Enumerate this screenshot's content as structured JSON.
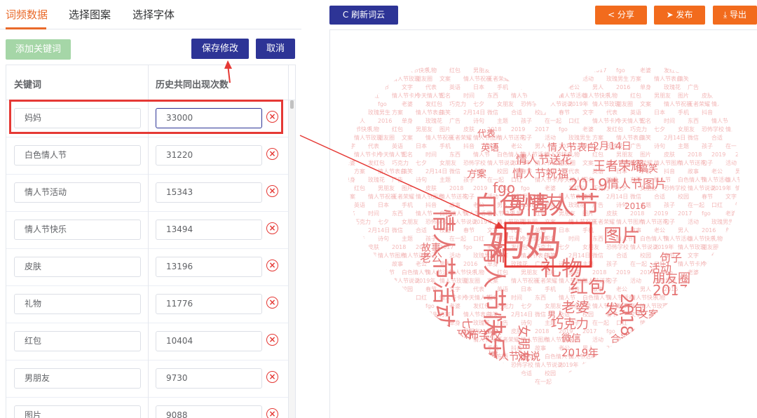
{
  "tabs": [
    {
      "label": "词频数据",
      "active": true
    },
    {
      "label": "选择图案",
      "active": false
    },
    {
      "label": "选择字体",
      "active": false
    }
  ],
  "buttons": {
    "add_keyword": "添加关键词",
    "save": "保存修改",
    "cancel": "取消"
  },
  "table": {
    "columns": [
      "关键词",
      "历史共同出现次数"
    ],
    "rows": [
      {
        "keyword": "妈妈",
        "count": "33000"
      },
      {
        "keyword": "白色情人节",
        "count": "31220"
      },
      {
        "keyword": "情人节活动",
        "count": "15343"
      },
      {
        "keyword": "情人节快乐",
        "count": "13494"
      },
      {
        "keyword": "皮肤",
        "count": "13196"
      },
      {
        "keyword": "礼物",
        "count": "11776"
      },
      {
        "keyword": "红包",
        "count": "10404"
      },
      {
        "keyword": "男朋友",
        "count": "9730"
      },
      {
        "keyword": "图片",
        "count": "9088"
      }
    ],
    "delete_icon": "⊗"
  },
  "toolbar": {
    "refresh": "C 刷新词云",
    "share": "< 分享",
    "publish": "➤ 发布",
    "export": "⤓ 导出"
  },
  "colors": {
    "accent": "#e96a2a",
    "primary": "#2d3496",
    "action": "#f26b1d",
    "add_disabled": "#a5d6a7",
    "highlight": "#e53935",
    "cloud_strong": "#e57373",
    "cloud_light": "#f3b8b8"
  },
  "cloud": {
    "highlight_word": "妈妈",
    "words": [
      {
        "t": "白色情人节"
      },
      {
        "t": "情人节活动"
      },
      {
        "t": "情人节快乐"
      },
      {
        "t": "礼物"
      },
      {
        "t": "红包"
      },
      {
        "t": "男朋友"
      },
      {
        "t": "图片"
      },
      {
        "t": "皮肤"
      },
      {
        "t": "2018"
      },
      {
        "t": "2019"
      },
      {
        "t": "2017"
      },
      {
        "t": "fgo"
      },
      {
        "t": "老婆"
      },
      {
        "t": "发红包"
      },
      {
        "t": "巧克力"
      },
      {
        "t": "七夕"
      },
      {
        "t": "女朋友"
      },
      {
        "t": "恐怖学校"
      },
      {
        "t": "情人节说说"
      },
      {
        "t": "2019年"
      },
      {
        "t": "情人节玫瑰"
      },
      {
        "t": "朋友圈"
      },
      {
        "t": "文案"
      },
      {
        "t": "情人节祝福"
      },
      {
        "t": "王者荣耀"
      },
      {
        "t": "情人节图片"
      },
      {
        "t": "情人节送花"
      },
      {
        "t": "句子"
      },
      {
        "t": "活动"
      },
      {
        "t": "玫瑰男生"
      },
      {
        "t": "方案"
      },
      {
        "t": "情人节表白"
      },
      {
        "t": "搞笑"
      },
      {
        "t": "2月14日"
      },
      {
        "t": "微信"
      },
      {
        "t": "合适"
      },
      {
        "t": "校园"
      },
      {
        "t": "春节"
      },
      {
        "t": "文字"
      },
      {
        "t": "代表"
      },
      {
        "t": "英语"
      },
      {
        "t": "日本"
      },
      {
        "t": "手机"
      },
      {
        "t": "抖音"
      },
      {
        "t": "故事"
      },
      {
        "t": "老公"
      },
      {
        "t": "男人"
      },
      {
        "t": "2016"
      },
      {
        "t": "单身"
      },
      {
        "t": "玫瑰花"
      },
      {
        "t": "广告"
      },
      {
        "t": "诗句"
      },
      {
        "t": "主题"
      },
      {
        "t": "孩子"
      },
      {
        "t": "在一起"
      },
      {
        "t": "口红"
      },
      {
        "t": "情人节卡片"
      },
      {
        "t": "今天情人节"
      },
      {
        "t": "起名"
      },
      {
        "t": "时间"
      },
      {
        "t": "东西"
      },
      {
        "t": "情人节"
      }
    ]
  }
}
